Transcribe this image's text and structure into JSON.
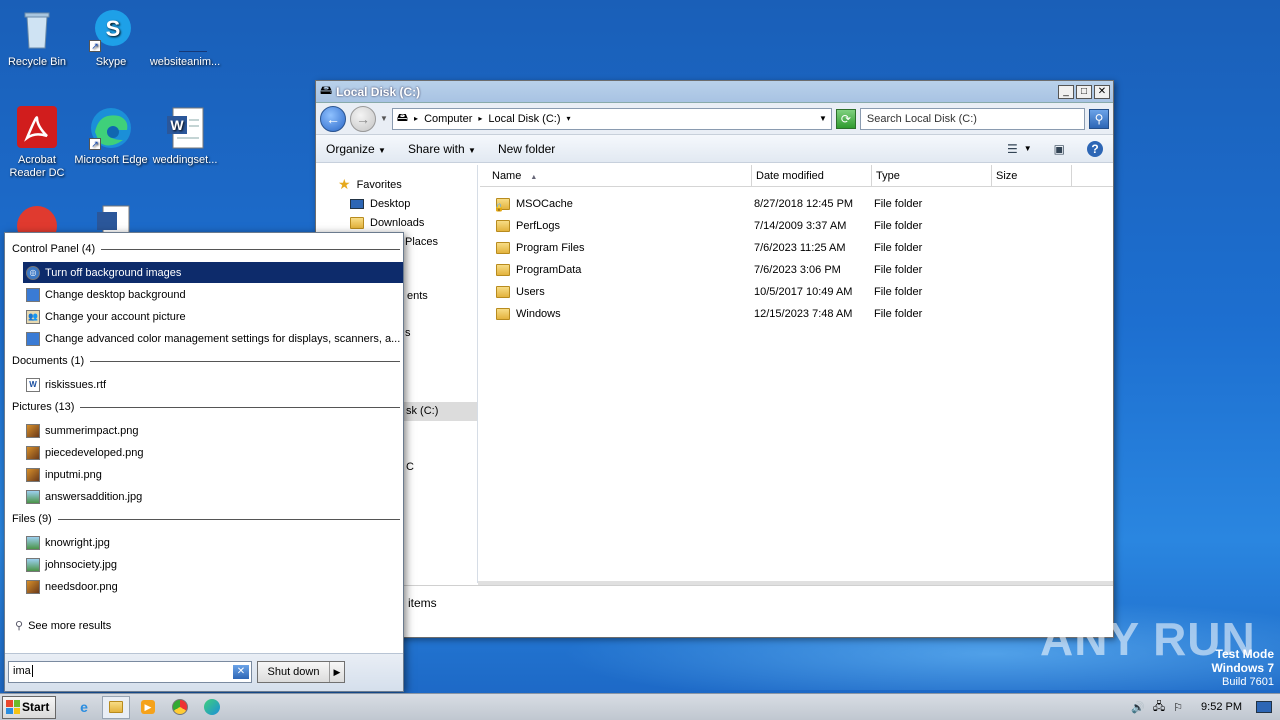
{
  "desktop": {
    "icons": [
      {
        "label": "Recycle Bin"
      },
      {
        "label": "Skype"
      },
      {
        "label": "websiteanim..."
      },
      {
        "label": "Acrobat Reader DC"
      },
      {
        "label": "Microsoft Edge"
      },
      {
        "label": "weddingset..."
      }
    ]
  },
  "explorer": {
    "title": "Local Disk (C:)",
    "breadcrumb": [
      "Computer",
      "Local Disk (C:)"
    ],
    "search_placeholder": "Search Local Disk (C:)",
    "toolbar": {
      "organize": "Organize",
      "share_with": "Share with",
      "new_folder": "New folder"
    },
    "nav": {
      "favorites": "Favorites",
      "desktop": "Desktop",
      "downloads": "Downloads",
      "recent_places_partial": "Places",
      "documents_partial": "ents",
      "s_partial": "s",
      "selected_partial": "sk (C:)",
      "c_partial": "C"
    },
    "columns": {
      "name": "Name",
      "date": "Date modified",
      "type": "Type",
      "size": "Size"
    },
    "files": [
      {
        "name": "MSOCache",
        "date": "8/27/2018 12:45 PM",
        "type": "File folder",
        "locked": true
      },
      {
        "name": "PerfLogs",
        "date": "7/14/2009 3:37 AM",
        "type": "File folder"
      },
      {
        "name": "Program Files",
        "date": "7/6/2023 11:25 AM",
        "type": "File folder"
      },
      {
        "name": "ProgramData",
        "date": "7/6/2023 3:06 PM",
        "type": "File folder"
      },
      {
        "name": "Users",
        "date": "10/5/2017 10:49 AM",
        "type": "File folder"
      },
      {
        "name": "Windows",
        "date": "12/15/2023 7:48 AM",
        "type": "File folder"
      }
    ],
    "status": "items"
  },
  "startmenu": {
    "categories": {
      "control_panel": "Control Panel (4)",
      "documents": "Documents (1)",
      "pictures": "Pictures (13)",
      "files": "Files (9)"
    },
    "control_panel_items": [
      "Turn off background images",
      "Change desktop background",
      "Change your account picture",
      "Change advanced color management settings for displays, scanners, a..."
    ],
    "document_items": [
      "riskissues.rtf"
    ],
    "picture_items": [
      "summerimpact.png",
      "piecedeveloped.png",
      "inputmi.png",
      "answersaddition.jpg"
    ],
    "file_items": [
      "knowright.jpg",
      "johnsociety.jpg",
      "needsdoor.png"
    ],
    "see_more": "See more results",
    "search_value": "ima",
    "shutdown": "Shut down"
  },
  "taskbar": {
    "start": "Start",
    "clock": "9:52 PM"
  },
  "watermark": "ANY RUN",
  "testmode": {
    "line1": "Test Mode",
    "line2": "Windows 7",
    "line3": "Build 7601"
  },
  "colors": {
    "selection": "#0d2b6b",
    "desktop": "#1d6fd0"
  }
}
